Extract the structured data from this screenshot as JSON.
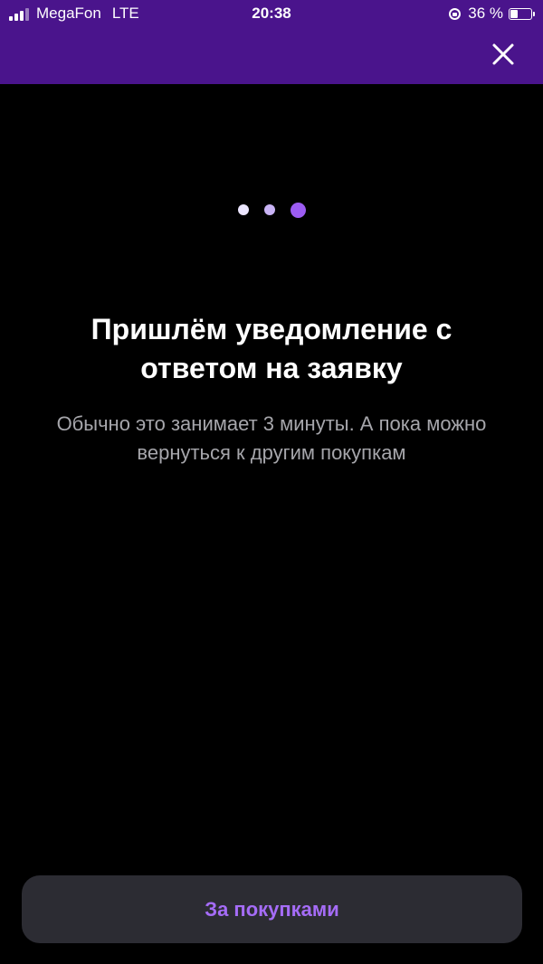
{
  "status_bar": {
    "carrier": "MegaFon",
    "network": "LTE",
    "time": "20:38",
    "battery_percent_text": "36 %",
    "battery_level": 0.36,
    "signal_bars_active": 3,
    "signal_bars_total": 4
  },
  "header": {
    "close_icon": "close-icon",
    "background_color": "#4a148c"
  },
  "stepper": {
    "steps": [
      {
        "color": "#ece6ff",
        "active": false
      },
      {
        "color": "#c9b3f5",
        "active": false
      },
      {
        "color": "#9c5cf2",
        "active": true
      }
    ]
  },
  "content": {
    "title": "Пришлём уведомление с ответом на заявку",
    "subtitle": "Обычно это занимает 3 минуты. А пока можно вернуться к другим покупкам"
  },
  "cta": {
    "label": "За покупками",
    "text_color": "#a56cf7",
    "background_color": "#2c2c33"
  }
}
